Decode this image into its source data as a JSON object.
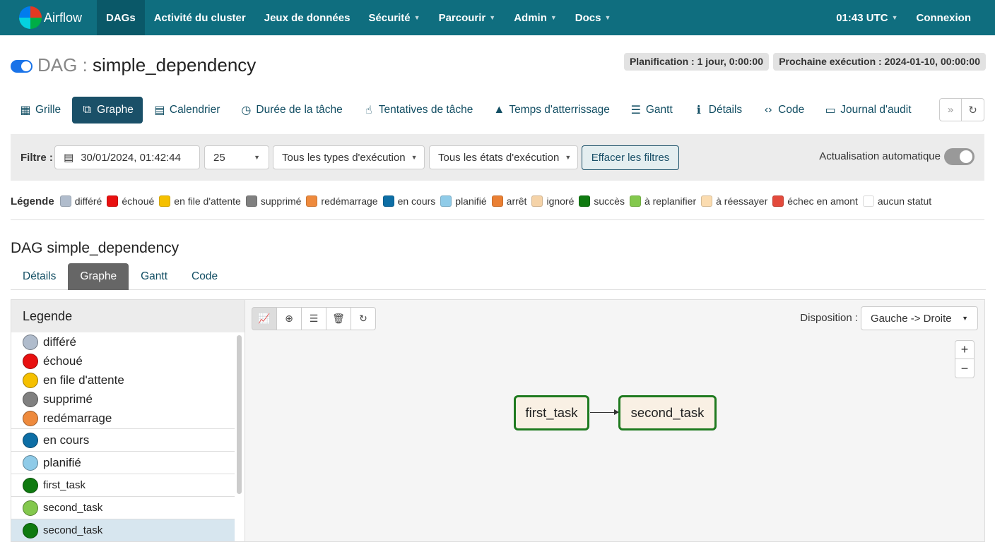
{
  "navbar": {
    "brand": "Airflow",
    "items": [
      {
        "label": "DAGs",
        "active": true,
        "caret": false
      },
      {
        "label": "Activité du cluster",
        "active": false,
        "caret": false
      },
      {
        "label": "Jeux de données",
        "active": false,
        "caret": false
      },
      {
        "label": "Sécurité",
        "active": false,
        "caret": true
      },
      {
        "label": "Parcourir",
        "active": false,
        "caret": true
      },
      {
        "label": "Admin",
        "active": false,
        "caret": true
      },
      {
        "label": "Docs",
        "active": false,
        "caret": true
      }
    ],
    "time": "01:43 UTC",
    "login": "Connexion"
  },
  "header": {
    "prefix": "DAG :",
    "dag_id": "simple_dependency",
    "schedule": "Planification : 1 jour, 0:00:00",
    "next_run": "Prochaine exécution : 2024-01-10, 00:00:00"
  },
  "view_tabs": [
    {
      "label": "Grille",
      "icon": "grid-icon",
      "glyph": "▦",
      "active": false
    },
    {
      "label": "Graphe",
      "icon": "graph-icon",
      "glyph": "⧉",
      "active": true
    },
    {
      "label": "Calendrier",
      "icon": "calendar-icon",
      "glyph": "▤",
      "active": false
    },
    {
      "label": "Durée de la tâche",
      "icon": "clock-icon",
      "glyph": "◷",
      "active": false
    },
    {
      "label": "Tentatives de tâche",
      "icon": "retry-hand-icon",
      "glyph": "☝",
      "active": false
    },
    {
      "label": "Temps d'atterrissage",
      "icon": "landing-icon",
      "glyph": "▲",
      "active": false
    },
    {
      "label": "Gantt",
      "icon": "gantt-icon",
      "glyph": "☰",
      "active": false
    },
    {
      "label": "Détails",
      "icon": "info-icon",
      "glyph": "ℹ",
      "active": false
    },
    {
      "label": "Code",
      "icon": "code-icon",
      "glyph": "‹›",
      "active": false
    },
    {
      "label": "Journal d'audit",
      "icon": "document-icon",
      "glyph": "▭",
      "active": false
    }
  ],
  "filters": {
    "label": "Filtre :",
    "date": "30/01/2024, 01:42:44",
    "count": "25",
    "run_types": "Tous les types d'exécution",
    "run_states": "Tous les états d'exécution",
    "clear": "Effacer les filtres",
    "auto_refresh": "Actualisation automatique"
  },
  "legend_strip": {
    "title": "Légende",
    "items": [
      {
        "label": "différé",
        "color": "#b0bccc"
      },
      {
        "label": "échoué",
        "color": "#e81010"
      },
      {
        "label": "en file d'attente",
        "color": "#f5c000"
      },
      {
        "label": "supprimé",
        "color": "#808080"
      },
      {
        "label": "redémarrage",
        "color": "#ee8a3d"
      },
      {
        "label": "en cours",
        "color": "#0d6ea5"
      },
      {
        "label": "planifié",
        "color": "#8fcbe8"
      },
      {
        "label": "arrêt",
        "color": "#ea8034"
      },
      {
        "label": "ignoré",
        "color": "#f5d3a8"
      },
      {
        "label": "succès",
        "color": "#0f7a10"
      },
      {
        "label": "à replanifier",
        "color": "#83c84d"
      },
      {
        "label": "à réessayer",
        "color": "#fbdcb0"
      },
      {
        "label": "échec en amont",
        "color": "#e34a3c"
      },
      {
        "label": "aucun statut",
        "color": "#ffffff"
      }
    ]
  },
  "subsection": {
    "title": "DAG simple_dependency",
    "tabs": [
      {
        "label": "Détails",
        "active": false
      },
      {
        "label": "Graphe",
        "active": true
      },
      {
        "label": "Gantt",
        "active": false
      },
      {
        "label": "Code",
        "active": false
      }
    ]
  },
  "graph_panel": {
    "legend_title": "Legende",
    "legend_rows": [
      {
        "label": "différé",
        "color": "#b0bccc",
        "sep": false,
        "sel": false,
        "h": 27
      },
      {
        "label": "échoué",
        "color": "#e81010",
        "sep": false,
        "sel": false,
        "h": 27
      },
      {
        "label": "en file d'attente",
        "color": "#f5c000",
        "sep": false,
        "sel": false,
        "h": 27
      },
      {
        "label": "supprimé",
        "color": "#808080",
        "sep": false,
        "sel": false,
        "h": 27
      },
      {
        "label": "redémarrage",
        "color": "#ee8a3d",
        "sep": false,
        "sel": false,
        "h": 28
      },
      {
        "label": "en cours",
        "color": "#0d6ea5",
        "sep": true,
        "sel": false,
        "h": 32
      },
      {
        "label": "planifié",
        "color": "#8fcbe8",
        "sep": true,
        "sel": false,
        "h": 32
      },
      {
        "label": "first_task",
        "color": "#0f7a10",
        "sep": true,
        "sel": false,
        "h": 32
      },
      {
        "label": "second_task",
        "color": "#83c84d",
        "sep": true,
        "sel": false,
        "h": 32
      },
      {
        "label": "second_task",
        "color": "#0f7a10",
        "sep": true,
        "sel": true,
        "h": 32
      }
    ],
    "layout_label": "Disposition :",
    "layout_value": "Gauche -> Droite",
    "zoom_in": "+",
    "zoom_out": "−",
    "nodes": {
      "first": "first_task",
      "second": "second_task"
    }
  }
}
